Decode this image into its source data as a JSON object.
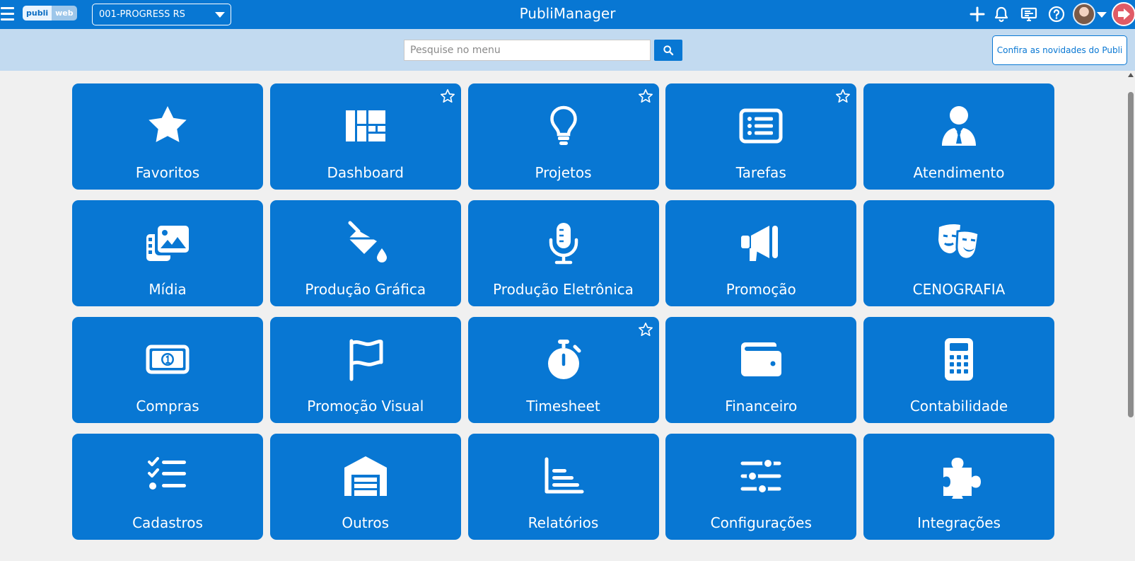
{
  "header": {
    "title": "PubliManager",
    "logo": {
      "part1": "publi",
      "part2": "web"
    },
    "company": "001-PROGRESS RS",
    "icons": [
      "menu-icon",
      "plus-icon",
      "bell-icon",
      "monitor-icon",
      "help-icon",
      "user-avatar",
      "chevron-down-icon",
      "logout-icon"
    ]
  },
  "search": {
    "placeholder": "Pesquise no menu",
    "value": "",
    "button_icon": "search-icon"
  },
  "news_button": {
    "label": "Confira as novidades do Publi"
  },
  "colors": {
    "primary": "#0877d3",
    "subbar": "#c2daf0",
    "background": "#f0f0f0",
    "logout": "#e05b66"
  },
  "tiles": [
    {
      "label": "Favoritos",
      "icon": "star-icon",
      "favorite_marker": false
    },
    {
      "label": "Dashboard",
      "icon": "dashboard-icon",
      "favorite_marker": true
    },
    {
      "label": "Projetos",
      "icon": "lightbulb-icon",
      "favorite_marker": true
    },
    {
      "label": "Tarefas",
      "icon": "task-list-icon",
      "favorite_marker": true
    },
    {
      "label": "Atendimento",
      "icon": "user-tie-icon",
      "favorite_marker": false
    },
    {
      "label": "Mídia",
      "icon": "photo-film-icon",
      "favorite_marker": false
    },
    {
      "label": "Produção Gráfica",
      "icon": "fill-drip-icon",
      "favorite_marker": false
    },
    {
      "label": "Produção Eletrônica",
      "icon": "microphone-icon",
      "favorite_marker": false
    },
    {
      "label": "Promoção",
      "icon": "megaphone-icon",
      "favorite_marker": false
    },
    {
      "label": "CENOGRAFIA",
      "icon": "theater-masks-icon",
      "favorite_marker": false
    },
    {
      "label": "Compras",
      "icon": "money-bill-icon",
      "favorite_marker": false
    },
    {
      "label": "Promoção Visual",
      "icon": "flag-icon",
      "favorite_marker": false
    },
    {
      "label": "Timesheet",
      "icon": "stopwatch-icon",
      "favorite_marker": true
    },
    {
      "label": "Financeiro",
      "icon": "wallet-icon",
      "favorite_marker": false
    },
    {
      "label": "Contabilidade",
      "icon": "calculator-icon",
      "favorite_marker": false
    },
    {
      "label": "Cadastros",
      "icon": "checklist-icon",
      "favorite_marker": false
    },
    {
      "label": "Outros",
      "icon": "warehouse-icon",
      "favorite_marker": false
    },
    {
      "label": "Relatórios",
      "icon": "bar-chart-icon",
      "favorite_marker": false
    },
    {
      "label": "Configurações",
      "icon": "sliders-icon",
      "favorite_marker": false
    },
    {
      "label": "Integrações",
      "icon": "puzzle-piece-icon",
      "favorite_marker": false
    }
  ]
}
